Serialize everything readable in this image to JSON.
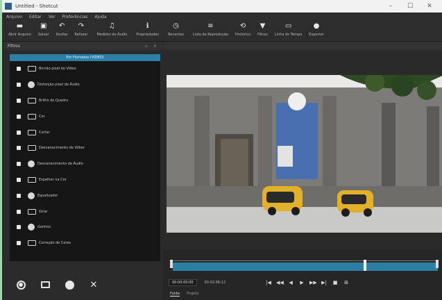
{
  "window": {
    "title": "Untitled - Shotcut",
    "min_glyph": "–",
    "max_glyph": "☐",
    "close_glyph": "✕"
  },
  "menu": [
    "Arquivo",
    "Editar",
    "Ver",
    "Preferências",
    "Ajuda"
  ],
  "toolbar": [
    {
      "label": "Abrir Arquivo",
      "icon": "open-folder-icon",
      "glyph": "▬"
    },
    {
      "label": "Salvar",
      "icon": "save-icon",
      "glyph": "▣"
    },
    {
      "label": "Desfaz",
      "icon": "undo-icon",
      "glyph": "↶"
    },
    {
      "label": "Refazer",
      "icon": "redo-icon",
      "glyph": "↷"
    },
    {
      "label": "Medidor de Áudio",
      "icon": "audio-meter-icon",
      "glyph": "♫"
    },
    {
      "label": "Propriedades",
      "icon": "properties-icon",
      "glyph": "ℹ"
    },
    {
      "label": "Recentes",
      "icon": "recent-icon",
      "glyph": "◷"
    },
    {
      "label": "Lista de Reprodução",
      "icon": "playlist-icon",
      "glyph": "≡"
    },
    {
      "label": "Histórico",
      "icon": "history-icon",
      "glyph": "⟲"
    },
    {
      "label": "Filtros",
      "icon": "filters-icon",
      "glyph": "▼"
    },
    {
      "label": "Linha do Tempo",
      "icon": "timeline-icon",
      "glyph": "▭"
    },
    {
      "label": "Exportar",
      "icon": "export-icon",
      "glyph": "●"
    }
  ],
  "left_panel": {
    "title": "Filtros",
    "header_buttons": "▫ ✕",
    "tab_label": "Em Formatos (VIDEO)",
    "filters": [
      {
        "label": "Borrão pixel do Vídeo",
        "icon": "monitor"
      },
      {
        "label": "Distorção pixel de Áudio",
        "icon": "circle"
      },
      {
        "label": "Brilho do Quadro",
        "icon": "monitor"
      },
      {
        "label": "Cor",
        "icon": "monitor"
      },
      {
        "label": "Cortar",
        "icon": "monitor"
      },
      {
        "label": "Desvanecimento de Vídeo",
        "icon": "monitor"
      },
      {
        "label": "Desvanecimento de Áudio",
        "icon": "circle"
      },
      {
        "label": "Espelhar na Cor",
        "icon": "monitor"
      },
      {
        "label": "Equalizador",
        "icon": "circle"
      },
      {
        "label": "Girar",
        "icon": "monitor"
      },
      {
        "label": "Ganhos",
        "icon": "circle"
      },
      {
        "label": "Correção de Cores",
        "icon": "monitor"
      }
    ]
  },
  "bottom_buttons": [
    "add-filter",
    "video-filter",
    "audio-filter",
    "remove-filter"
  ],
  "player": {
    "timecode": "00:00:00:00",
    "duration": "00:02:06:12",
    "transport": [
      "|◀",
      "◀◀",
      "◀",
      "▶",
      "▶▶",
      "▶|",
      "■",
      "⊞"
    ],
    "tabs": [
      "Fonte",
      "Projeto"
    ],
    "active_tab": 0,
    "playhead_fraction": 0.72
  },
  "colors": {
    "accent": "#2c7fa6",
    "window_bg": "#2a2a2a",
    "title_bg": "#f2f2f2"
  }
}
